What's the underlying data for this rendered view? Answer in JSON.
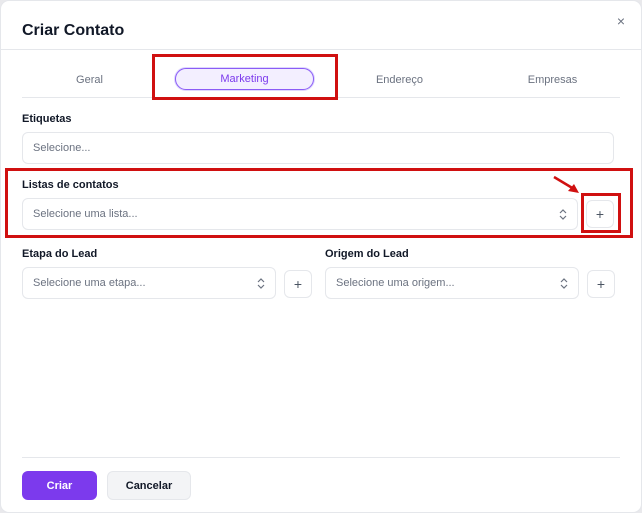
{
  "dialog": {
    "title": "Criar Contato",
    "close_icon": "×"
  },
  "tabs": [
    {
      "label": "Geral",
      "active": false
    },
    {
      "label": "Marketing",
      "active": true
    },
    {
      "label": "Endereço",
      "active": false
    },
    {
      "label": "Empresas",
      "active": false
    }
  ],
  "fields": {
    "etiquetas": {
      "label": "Etiquetas",
      "placeholder": "Selecione..."
    },
    "listas": {
      "label": "Listas de contatos",
      "placeholder": "Selecione uma lista...",
      "add": "+"
    },
    "etapa": {
      "label": "Etapa do Lead",
      "placeholder": "Selecione uma etapa...",
      "add": "+"
    },
    "origem": {
      "label": "Origem do Lead",
      "placeholder": "Selecione uma origem...",
      "add": "+"
    }
  },
  "icons": {
    "close": "close-icon",
    "chevron": "chevron-up-down-icon",
    "plus": "plus-icon"
  },
  "footer": {
    "submit": "Criar",
    "cancel": "Cancelar"
  },
  "colors": {
    "accent": "#7c3aed",
    "annotation": "#d01010"
  }
}
